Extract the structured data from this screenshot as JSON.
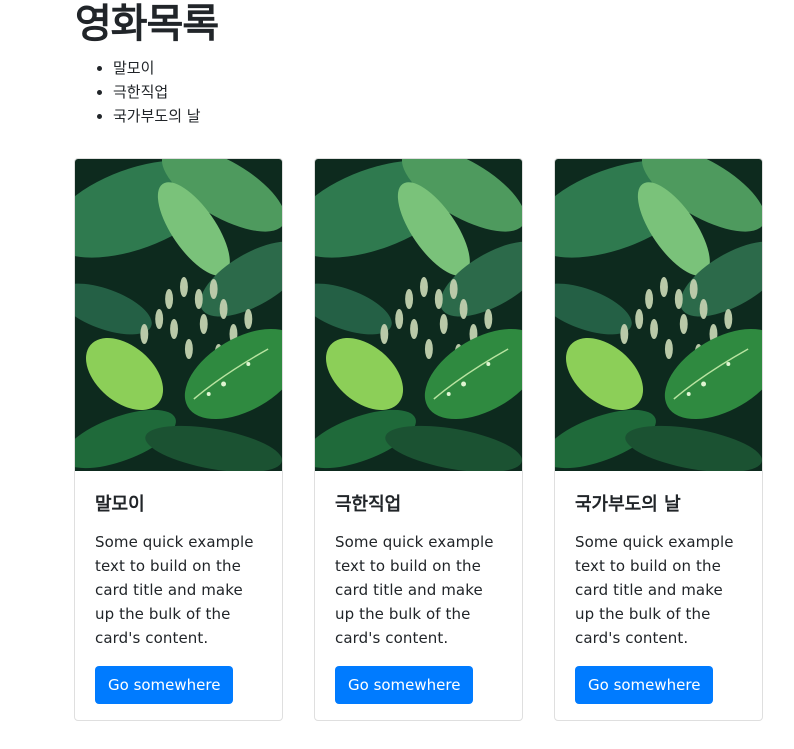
{
  "page": {
    "title": "영화목록"
  },
  "movies": [
    {
      "title": "말모이",
      "text": "Some quick example text to build on the card title and make up the bulk of the card's content.",
      "button": "Go somewhere"
    },
    {
      "title": "극한직업",
      "text": "Some quick example text to build on the card title and make up the bulk of the card's content.",
      "button": "Go somewhere"
    },
    {
      "title": "국가부도의 날",
      "text": "Some quick example text to build on the card title and make up the bulk of the card's content.",
      "button": "Go somewhere"
    }
  ],
  "colors": {
    "primary": "#007bff",
    "text": "#212529",
    "border": "#dfdfdf"
  }
}
